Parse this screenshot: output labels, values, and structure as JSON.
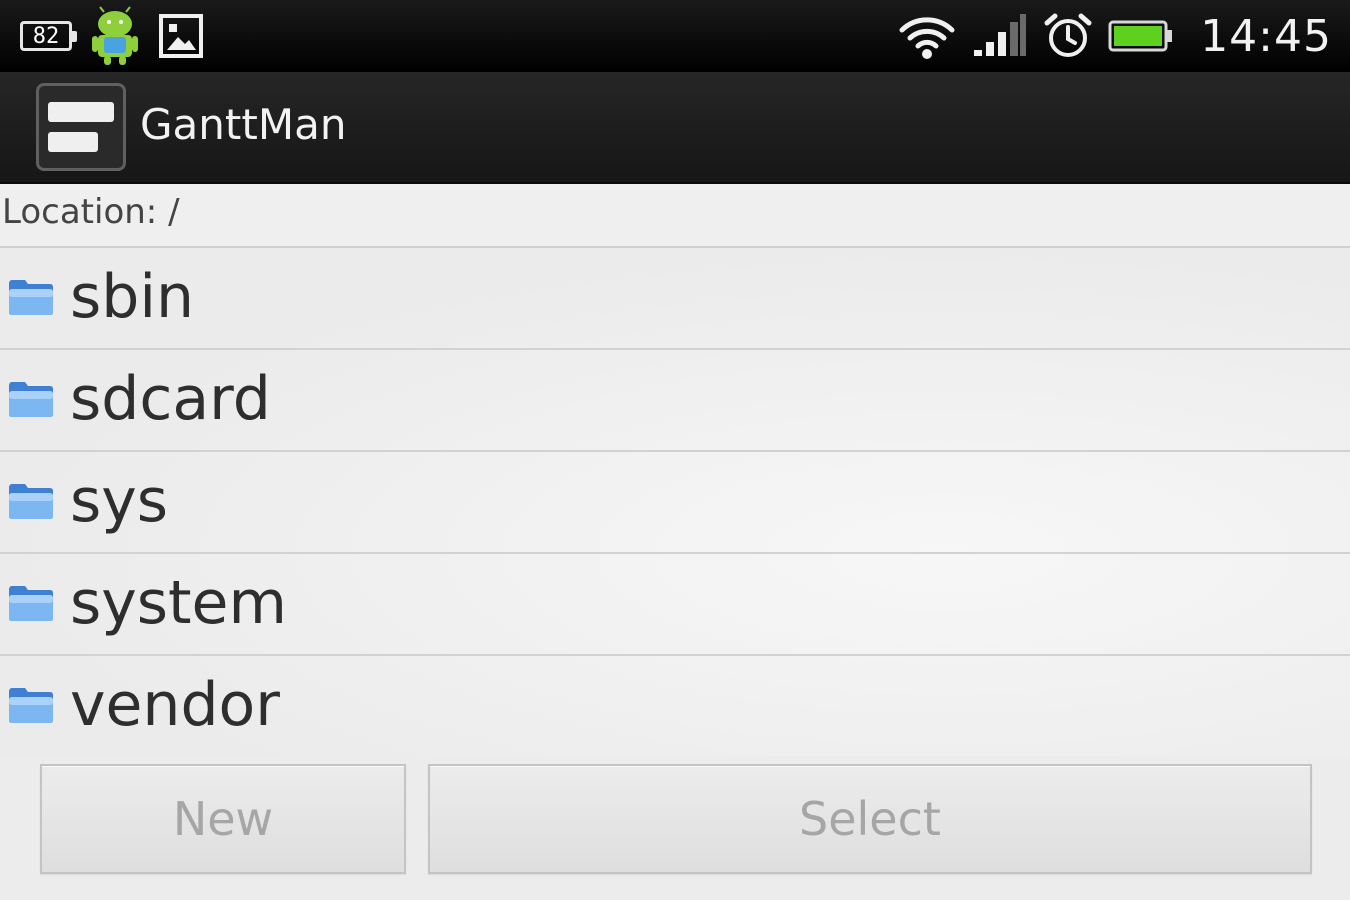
{
  "status_bar": {
    "battery_level": "82",
    "time": "14:45",
    "icons": [
      "battery-level-icon",
      "android-icon",
      "gallery-icon",
      "wifi-icon",
      "signal-icon",
      "alarm-icon",
      "battery-icon"
    ]
  },
  "action_bar": {
    "title": "GanttMan",
    "icon": "app-icon"
  },
  "location": {
    "label": "Location: /"
  },
  "files": [
    {
      "name": "sbin",
      "icon": "folder-icon"
    },
    {
      "name": "sdcard",
      "icon": "folder-icon"
    },
    {
      "name": "sys",
      "icon": "folder-icon"
    },
    {
      "name": "system",
      "icon": "folder-icon"
    },
    {
      "name": "vendor",
      "icon": "folder-icon"
    }
  ],
  "buttons": {
    "new_label": "New",
    "select_label": "Select"
  },
  "colors": {
    "folder_blue": "#5a9de8",
    "battery_green": "#5ed11e",
    "button_text_disabled": "#a6a6a6"
  }
}
